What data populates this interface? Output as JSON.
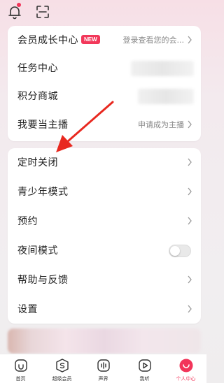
{
  "colors": {
    "accent": "#f2355a",
    "arrow": "#e8281f"
  },
  "icons": {
    "bell": "bell-icon",
    "scan": "scan-icon"
  },
  "card1": {
    "items": [
      {
        "label": "会员成长中心",
        "badge": "NEW",
        "value": "登录查看您的会..."
      },
      {
        "label": "任务中心"
      },
      {
        "label": "积分商城"
      },
      {
        "label": "我要当主播",
        "value": "申请成为主播"
      }
    ]
  },
  "card2": {
    "items": [
      {
        "label": "定时关闭"
      },
      {
        "label": "青少年模式"
      },
      {
        "label": "预约"
      },
      {
        "label": "夜间模式",
        "toggle_on": false
      },
      {
        "label": "帮助与反馈"
      },
      {
        "label": "设置"
      }
    ]
  },
  "tabbar": {
    "tabs": [
      {
        "label": "首页",
        "icon": "home-icon"
      },
      {
        "label": "超级会员",
        "icon": "vip-icon"
      },
      {
        "label": "声界",
        "icon": "soundwave-icon"
      },
      {
        "label": "我听",
        "icon": "play-icon"
      },
      {
        "label": "个人中心",
        "icon": "profile-icon",
        "active": true
      }
    ]
  }
}
